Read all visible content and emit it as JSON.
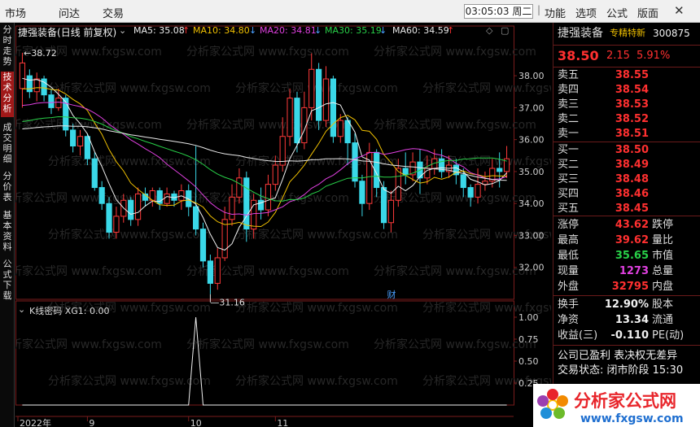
{
  "menu": {
    "items": [
      "市场",
      "问达",
      "交易"
    ],
    "right_items": [
      "功能",
      "选项",
      "公式",
      "版面"
    ],
    "clock": "03:05:03 周二"
  },
  "left_tabs": [
    "分时走势",
    "技术分析",
    "成交明细",
    "分价表",
    "基本资料",
    "公式下载"
  ],
  "stock_header": {
    "name_prefix": "捷强装备",
    "chart_mode": "(日线 前复权)",
    "ma": [
      {
        "label": "MA5: 35.08",
        "color": "#f0f0f0"
      },
      {
        "label": "MA10: 34.80",
        "color": "#f0c000"
      },
      {
        "label": "MA20: 34.81",
        "color": "#e040e0"
      },
      {
        "label": "MA30: 35.19",
        "color": "#28d048"
      },
      {
        "label": "MA60: 34.59",
        "color": "#e8e8e8"
      }
    ],
    "high_mark": "38.72",
    "low_mark": "31.16",
    "fin_mark": "财"
  },
  "price_axis": [
    "38.00",
    "37.00",
    "36.00",
    "35.00",
    "34.00",
    "33.00",
    "32.00"
  ],
  "indicator": {
    "title": "K线密码 XG1: 0.00",
    "axis": [
      "1.00",
      "0.75",
      "0.50",
      "0.25"
    ]
  },
  "date_axis": [
    "2022年",
    "9",
    "10",
    "11"
  ],
  "right_panel": {
    "name": "捷强装备",
    "tag": "专精特新",
    "code": "300875",
    "price": "38.50",
    "change": "2.15",
    "pct": "5.91%",
    "asks": [
      {
        "label": "卖五",
        "price": "38.55"
      },
      {
        "label": "卖四",
        "price": "38.54"
      },
      {
        "label": "卖三",
        "price": "38.53"
      },
      {
        "label": "卖二",
        "price": "38.52"
      },
      {
        "label": "卖一",
        "price": "38.51"
      }
    ],
    "bids": [
      {
        "label": "买一",
        "price": "38.50"
      },
      {
        "label": "买二",
        "price": "38.49"
      },
      {
        "label": "买三",
        "price": "38.48"
      },
      {
        "label": "买四",
        "price": "38.46"
      },
      {
        "label": "买五",
        "price": "38.45"
      }
    ],
    "stats1": [
      {
        "label": "涨停",
        "value": "43.62",
        "label2": "跌停",
        "cls": "red"
      },
      {
        "label": "最高",
        "value": "39.62",
        "label2": "量比",
        "cls": "red"
      },
      {
        "label": "最低",
        "value": "35.65",
        "label2": "市值",
        "cls": "green"
      },
      {
        "label": "现量",
        "value": "1273",
        "label2": "总量",
        "cls": "mag"
      },
      {
        "label": "外盘",
        "value": "32795",
        "label2": "内盘",
        "cls": "red"
      }
    ],
    "stats2": [
      {
        "label": "换手",
        "value": "12.90%",
        "label2": "股本",
        "cls": "white"
      },
      {
        "label": "净资",
        "value": "13.34",
        "label2": "流通",
        "cls": "white"
      },
      {
        "label": "收益(三)",
        "value": "-0.110",
        "label2": "PE(动)",
        "cls": "white"
      }
    ],
    "notes": [
      "公司已盈利 表决权无差异",
      "交易状态: 闭市阶段 15:30"
    ]
  },
  "watermark": "分析家公式网 www.fxgsw.com",
  "logo": {
    "text": "分析家公式网",
    "url": "www.fxgsw.com"
  },
  "chart_data": {
    "type": "candlestick",
    "ylim": [
      31.0,
      39.2
    ],
    "candles": [
      [
        37.6,
        38.4,
        37.0,
        38.72
      ],
      [
        38.0,
        37.5,
        37.3,
        38.2
      ],
      [
        37.5,
        37.9,
        37.2,
        38.1
      ],
      [
        37.9,
        37.4,
        37.2,
        38.0
      ],
      [
        37.4,
        37.0,
        36.8,
        37.6
      ],
      [
        37.0,
        37.3,
        36.9,
        37.6
      ],
      [
        37.3,
        36.3,
        36.1,
        37.4
      ],
      [
        36.3,
        35.8,
        35.6,
        36.5
      ],
      [
        35.8,
        36.1,
        35.5,
        36.3
      ],
      [
        36.1,
        35.4,
        35.2,
        36.2
      ],
      [
        35.4,
        34.5,
        34.4,
        35.6
      ],
      [
        34.5,
        34.0,
        33.8,
        34.7
      ],
      [
        34.0,
        33.1,
        32.9,
        34.2
      ],
      [
        33.1,
        33.6,
        32.9,
        33.9
      ],
      [
        33.6,
        34.1,
        33.4,
        34.3
      ],
      [
        34.1,
        33.5,
        33.3,
        34.2
      ],
      [
        33.5,
        34.3,
        33.3,
        34.5
      ],
      [
        34.3,
        34.1,
        33.9,
        34.5
      ],
      [
        34.1,
        34.4,
        33.9,
        34.5
      ],
      [
        34.4,
        34.0,
        33.8,
        34.5
      ],
      [
        34.0,
        34.3,
        33.9,
        34.5
      ],
      [
        34.3,
        34.1,
        33.9,
        34.4
      ],
      [
        34.1,
        34.4,
        33.8,
        34.6
      ],
      [
        34.4,
        33.9,
        33.6,
        34.6
      ],
      [
        33.9,
        33.2,
        33.0,
        35.8
      ],
      [
        33.2,
        32.2,
        32.0,
        33.4
      ],
      [
        32.2,
        31.5,
        31.16,
        32.4
      ],
      [
        31.5,
        32.3,
        31.3,
        32.6
      ],
      [
        32.3,
        33.5,
        32.2,
        33.9
      ],
      [
        33.5,
        34.2,
        33.3,
        34.6
      ],
      [
        34.2,
        34.8,
        34.0,
        35.1
      ],
      [
        34.8,
        33.2,
        32.8,
        35.0
      ],
      [
        33.2,
        34.1,
        32.9,
        34.3
      ],
      [
        34.1,
        33.8,
        33.5,
        34.5
      ],
      [
        33.8,
        34.6,
        33.6,
        34.9
      ],
      [
        34.6,
        35.2,
        34.4,
        35.5
      ],
      [
        35.2,
        36.1,
        35.0,
        36.7
      ],
      [
        36.1,
        37.3,
        35.8,
        37.6
      ],
      [
        37.3,
        35.9,
        35.6,
        37.5
      ],
      [
        35.9,
        37.0,
        35.7,
        37.5
      ],
      [
        37.0,
        38.2,
        36.6,
        38.7
      ],
      [
        38.2,
        36.6,
        36.3,
        38.4
      ],
      [
        36.6,
        37.9,
        36.4,
        38.3
      ],
      [
        37.9,
        36.1,
        35.9,
        38.0
      ],
      [
        36.1,
        36.6,
        35.9,
        36.8
      ],
      [
        36.6,
        35.9,
        35.2,
        36.7
      ],
      [
        35.9,
        34.7,
        34.5,
        36.2
      ],
      [
        34.7,
        34.0,
        33.6,
        34.9
      ],
      [
        34.0,
        35.6,
        33.8,
        35.9
      ],
      [
        35.6,
        34.5,
        34.2,
        35.7
      ],
      [
        34.5,
        33.4,
        33.2,
        34.7
      ],
      [
        33.4,
        34.1,
        33.1,
        34.4
      ],
      [
        34.1,
        35.1,
        33.9,
        35.4
      ],
      [
        35.1,
        34.9,
        34.6,
        35.6
      ],
      [
        34.9,
        35.3,
        34.7,
        35.6
      ],
      [
        35.3,
        34.8,
        34.3,
        35.7
      ],
      [
        34.8,
        35.1,
        34.6,
        35.5
      ],
      [
        35.1,
        35.4,
        34.9,
        35.7
      ],
      [
        35.4,
        35.0,
        34.8,
        35.7
      ],
      [
        35.0,
        35.2,
        34.8,
        35.5
      ],
      [
        35.2,
        34.9,
        34.6,
        35.4
      ],
      [
        34.9,
        34.5,
        34.2,
        35.1
      ],
      [
        34.5,
        34.2,
        33.9,
        34.6
      ],
      [
        34.2,
        34.6,
        34.0,
        35.1
      ],
      [
        34.6,
        34.7,
        34.4,
        35.0
      ],
      [
        34.7,
        35.1,
        34.5,
        35.4
      ],
      [
        35.1,
        35.0,
        34.5,
        35.6
      ],
      [
        35.0,
        35.4,
        34.8,
        35.8
      ]
    ],
    "indicator_spike": {
      "bar_index": 24,
      "value": 1.0
    }
  }
}
